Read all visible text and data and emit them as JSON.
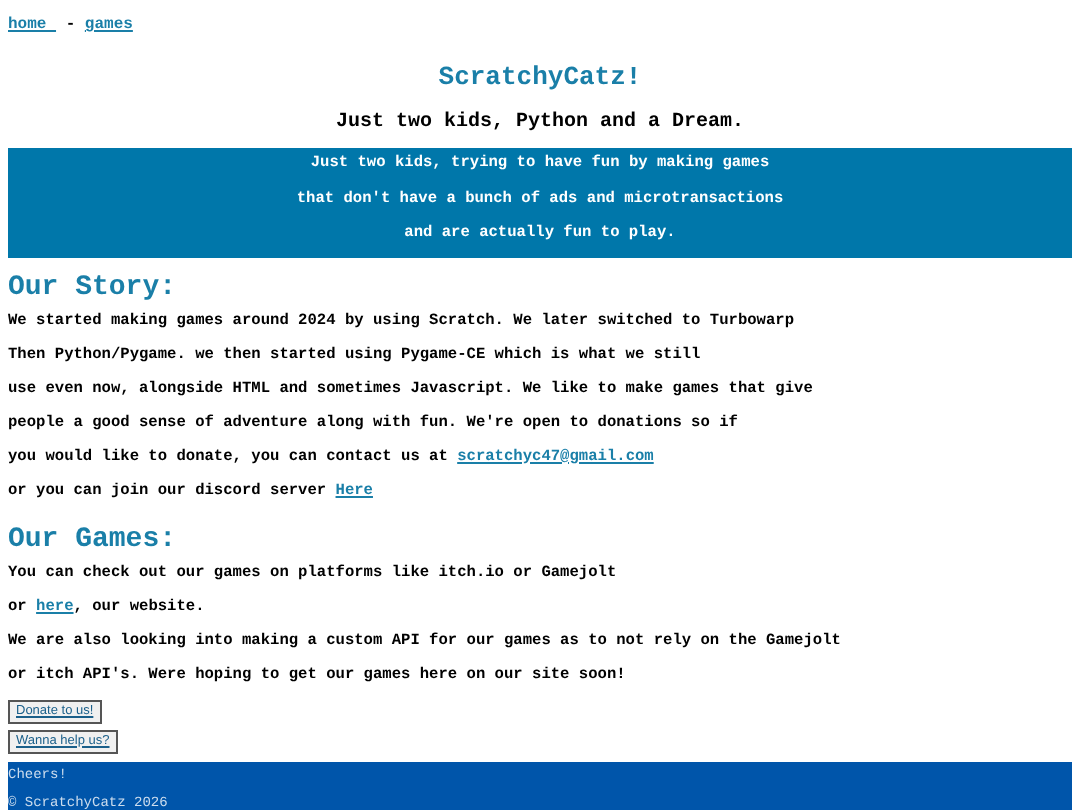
{
  "nav": [
    {
      "kind": "link",
      "text": "home "
    },
    {
      "kind": "text",
      "text": " - "
    },
    {
      "kind": "link",
      "text": "games"
    }
  ],
  "title": "ScratchyCatz!",
  "subtitle": "Just two kids, Python and a Dream.",
  "banner_lines": [
    "Just two kids, trying to have fun by making games",
    "that don't have a bunch of ads and microtransactions",
    "and are actually fun to play."
  ],
  "sections": [
    {
      "heading": "Our Story:",
      "lines": [
        [
          {
            "kind": "text",
            "text": "We started making games around 2024 by using Scratch. We later switched to Turbowarp"
          }
        ],
        [
          {
            "kind": "text",
            "text": "Then Python/Pygame. we then started using Pygame-CE which is what we still"
          }
        ],
        [
          {
            "kind": "text",
            "text": "use even now, alongside HTML and sometimes Javascript. We like to make games that give"
          }
        ],
        [
          {
            "kind": "text",
            "text": "people a good sense of adventure along with fun. We're open to donations so if"
          }
        ],
        [
          {
            "kind": "text",
            "text": "you would like to donate, you can contact us at "
          },
          {
            "kind": "link",
            "text": "scratchyc47@gmail.com"
          }
        ],
        [
          {
            "kind": "text",
            "text": "or you can join our discord server "
          },
          {
            "kind": "link",
            "text": "Here"
          }
        ]
      ]
    },
    {
      "heading": "Our Games:",
      "lines": [
        [
          {
            "kind": "text",
            "text": "You can check out our games on platforms like itch.io or Gamejolt"
          }
        ],
        [
          {
            "kind": "text",
            "text": "or "
          },
          {
            "kind": "link",
            "text": "here"
          },
          {
            "kind": "text",
            "text": ", our website."
          }
        ],
        [
          {
            "kind": "text",
            "text": "We are also looking into making a custom API for our games as to not rely on the Gamejolt"
          }
        ],
        [
          {
            "kind": "text",
            "text": "or itch API's. Were hoping to get our games here on our site soon!"
          }
        ]
      ]
    }
  ],
  "buttons": [
    "Donate to us!",
    "Wanna help us?"
  ],
  "footer_lines": [
    "Cheers!",
    "© ScratchyCatz 2026"
  ]
}
